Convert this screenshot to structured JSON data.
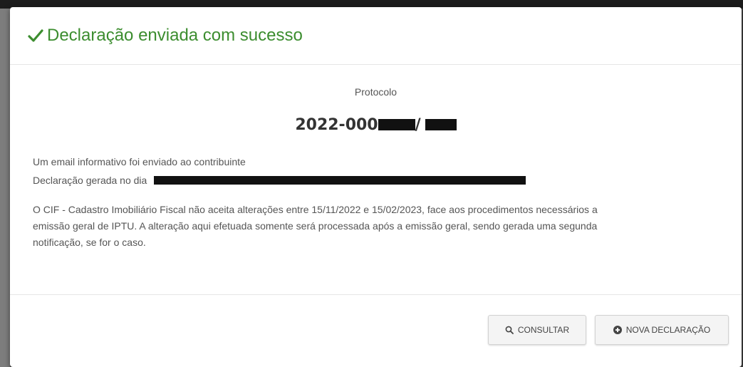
{
  "modal": {
    "title": "Declaração enviada com sucesso",
    "title_color": "#3c8d2f",
    "title_icon": "check-icon"
  },
  "body": {
    "protocol_label": "Protocolo",
    "protocol_value_prefix": "2022-000",
    "protocol_value_mid": "/",
    "email_line": "Um email informativo foi enviado ao contribuinte",
    "date_line_label": "Declaração gerada no dia",
    "notice_line_1": "O CIF - Cadastro Imobiliário Fiscal não aceita alterações entre 15/11/2022 e 15/02/2023, face aos procedimentos necessários a",
    "notice_line_2": "emissão geral de IPTU. A alteração aqui efetuada somente será processada após a emissão geral, sendo gerada uma segunda",
    "notice_line_3": "notificação, se for o caso."
  },
  "footer": {
    "consult_label": "CONSULTAR",
    "consult_icon": "search-icon",
    "new_declaration_label": "NOVA DECLARAÇÃO",
    "new_declaration_icon": "plus-circle-icon"
  }
}
